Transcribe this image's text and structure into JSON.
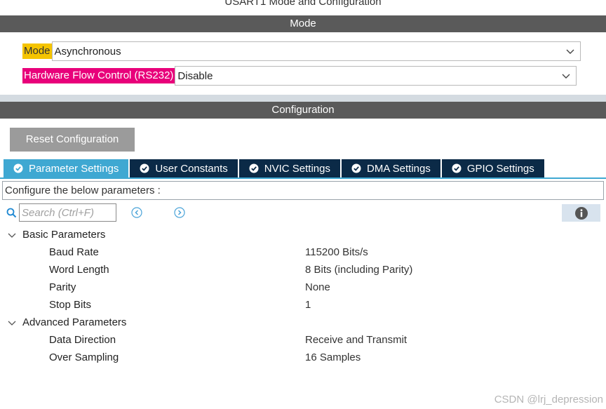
{
  "window": {
    "title": "USART1 Mode and Configuration"
  },
  "mode_section": {
    "title": "Mode",
    "rows": [
      {
        "label": "Mode",
        "value": "Asynchronous"
      },
      {
        "label": "Hardware Flow Control (RS232)",
        "value": "Disable"
      }
    ]
  },
  "config_section": {
    "title": "Configuration",
    "reset_label": "Reset Configuration",
    "tabs": [
      {
        "label": "Parameter Settings",
        "active": true
      },
      {
        "label": "User Constants",
        "active": false
      },
      {
        "label": "NVIC Settings",
        "active": false
      },
      {
        "label": "DMA Settings",
        "active": false
      },
      {
        "label": "GPIO Settings",
        "active": false
      }
    ],
    "info_text": "Configure the below parameters :",
    "search_placeholder": "Search (Ctrl+F)"
  },
  "groups": [
    {
      "name": "Basic Parameters",
      "params": [
        {
          "name": "Baud Rate",
          "value": "115200 Bits/s"
        },
        {
          "name": "Word Length",
          "value": "8 Bits (including Parity)"
        },
        {
          "name": "Parity",
          "value": "None"
        },
        {
          "name": "Stop Bits",
          "value": "1"
        }
      ]
    },
    {
      "name": "Advanced Parameters",
      "params": [
        {
          "name": "Data Direction",
          "value": "Receive and Transmit"
        },
        {
          "name": "Over Sampling",
          "value": "16 Samples"
        }
      ]
    }
  ],
  "watermark": "CSDN @lrj_depression",
  "colors": {
    "section_bar": "#5a5a5a",
    "mode_highlight": "#f5c400",
    "flow_highlight": "#e8007a",
    "tab_active": "#3fa8d2",
    "tab_inactive": "#0b2a47",
    "button_grey": "#9b9b9b"
  },
  "icons": {
    "search": "search-icon",
    "prev": "previous-match-icon",
    "next": "next-match-icon",
    "info": "info-icon",
    "tab_check": "check-circle-icon",
    "expand": "chevron-down-icon",
    "dropdown": "chevron-down-icon"
  }
}
